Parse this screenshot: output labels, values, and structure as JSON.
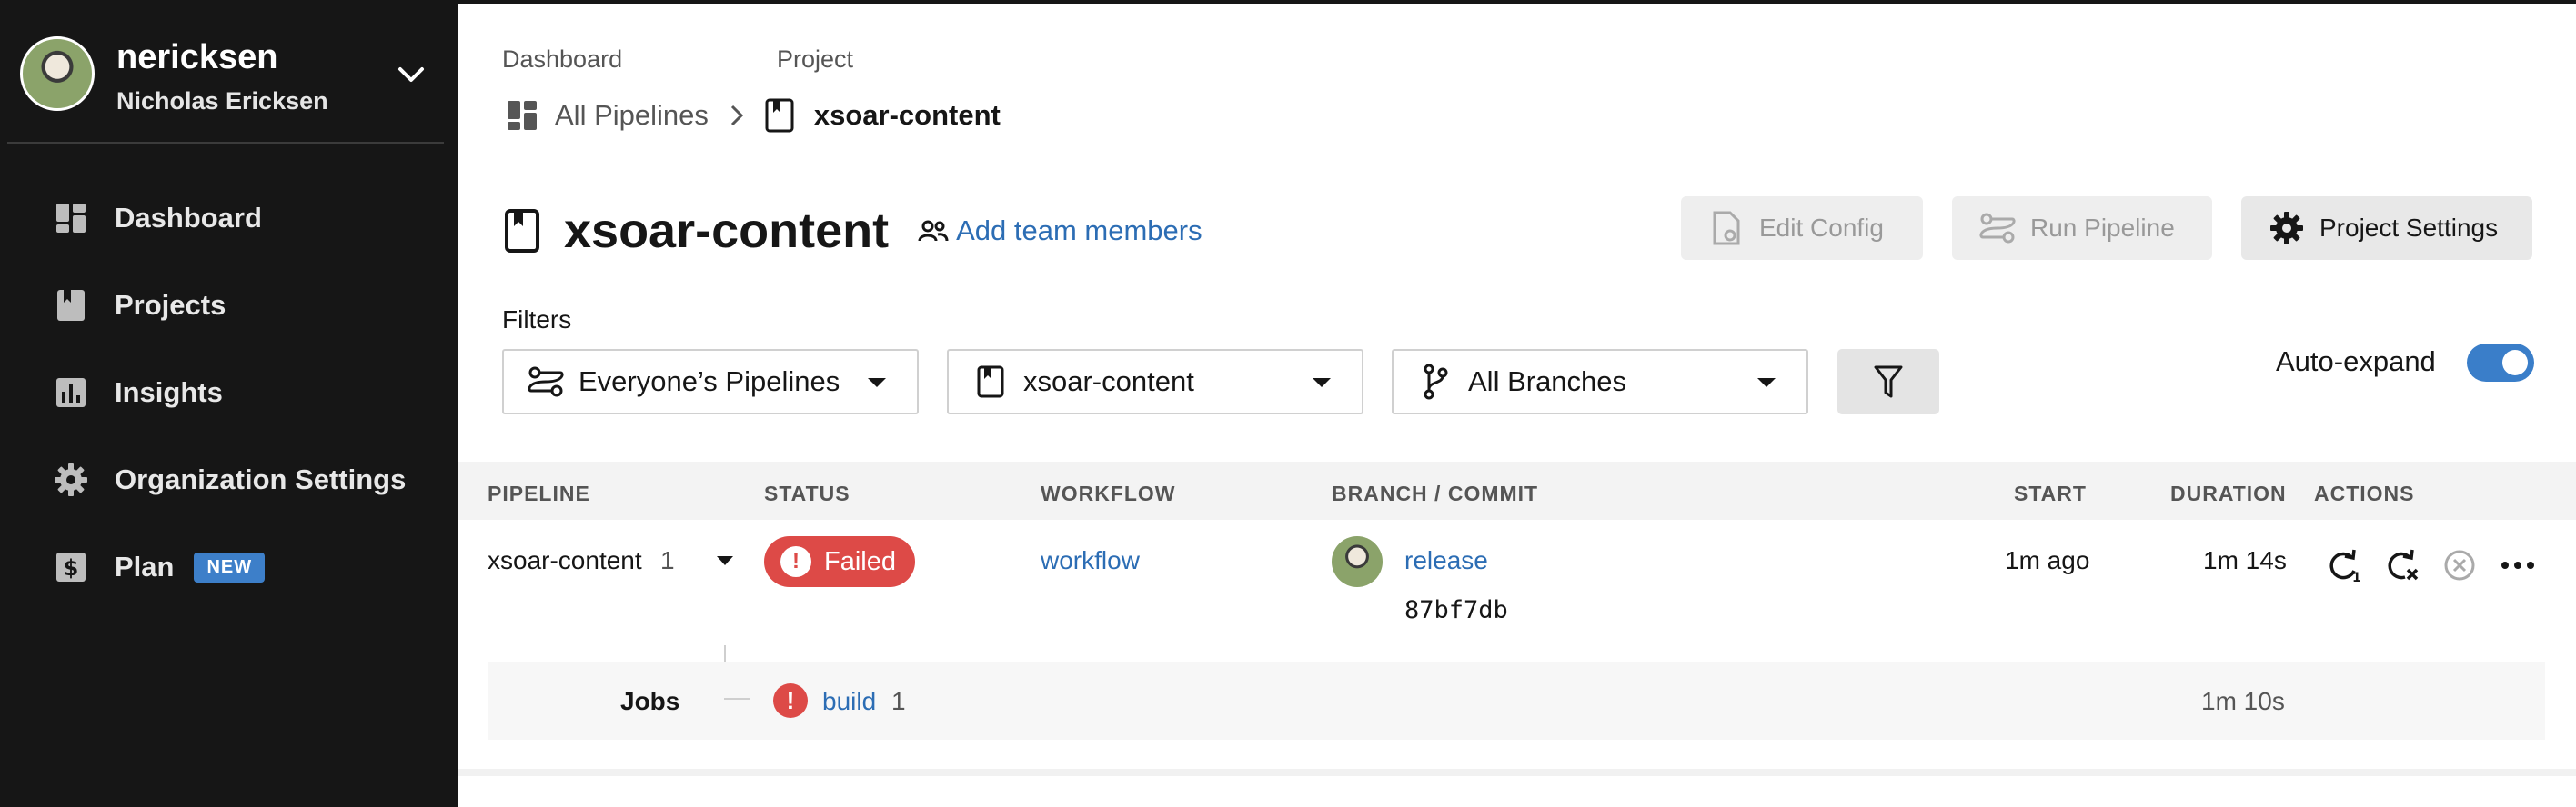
{
  "user": {
    "username": "nericksen",
    "full_name": "Nicholas Ericksen"
  },
  "sidebar": {
    "items": [
      {
        "label": "Dashboard",
        "icon": "dashboard-icon"
      },
      {
        "label": "Projects",
        "icon": "projects-icon"
      },
      {
        "label": "Insights",
        "icon": "insights-icon"
      },
      {
        "label": "Organization Settings",
        "icon": "gear-icon"
      },
      {
        "label": "Plan",
        "icon": "dollar-icon",
        "badge": "NEW"
      }
    ]
  },
  "breadcrumb": {
    "dashboard_label": "Dashboard",
    "project_label": "Project",
    "dashboard_link": "All Pipelines",
    "project_name": "xsoar-content"
  },
  "header": {
    "title": "xsoar-content",
    "add_team": "Add team members",
    "edit_config": "Edit Config",
    "run_pipeline": "Run Pipeline",
    "project_settings": "Project Settings"
  },
  "filters": {
    "label": "Filters",
    "pipelines": "Everyone’s Pipelines",
    "project": "xsoar-content",
    "branches": "All Branches",
    "auto_expand": "Auto-expand",
    "auto_expand_on": true
  },
  "table": {
    "headers": {
      "pipeline": "PIPELINE",
      "status": "STATUS",
      "workflow": "WORKFLOW",
      "branch_commit": "BRANCH / COMMIT",
      "start": "START",
      "duration": "DURATION",
      "actions": "ACTIONS"
    },
    "rows": [
      {
        "pipeline": "xsoar-content",
        "number": "1",
        "status": "Failed",
        "workflow": "workflow",
        "branch": "release",
        "commit": "87bf7db",
        "start": "1m ago",
        "duration": "1m 14s",
        "jobs_label": "Jobs",
        "job_name": "build",
        "job_number": "1",
        "job_duration": "1m 10s"
      }
    ]
  },
  "colors": {
    "accent": "#2c6db4",
    "failed": "#dd4a47",
    "toggle": "#3a7ec9",
    "sidebar": "#161616"
  }
}
